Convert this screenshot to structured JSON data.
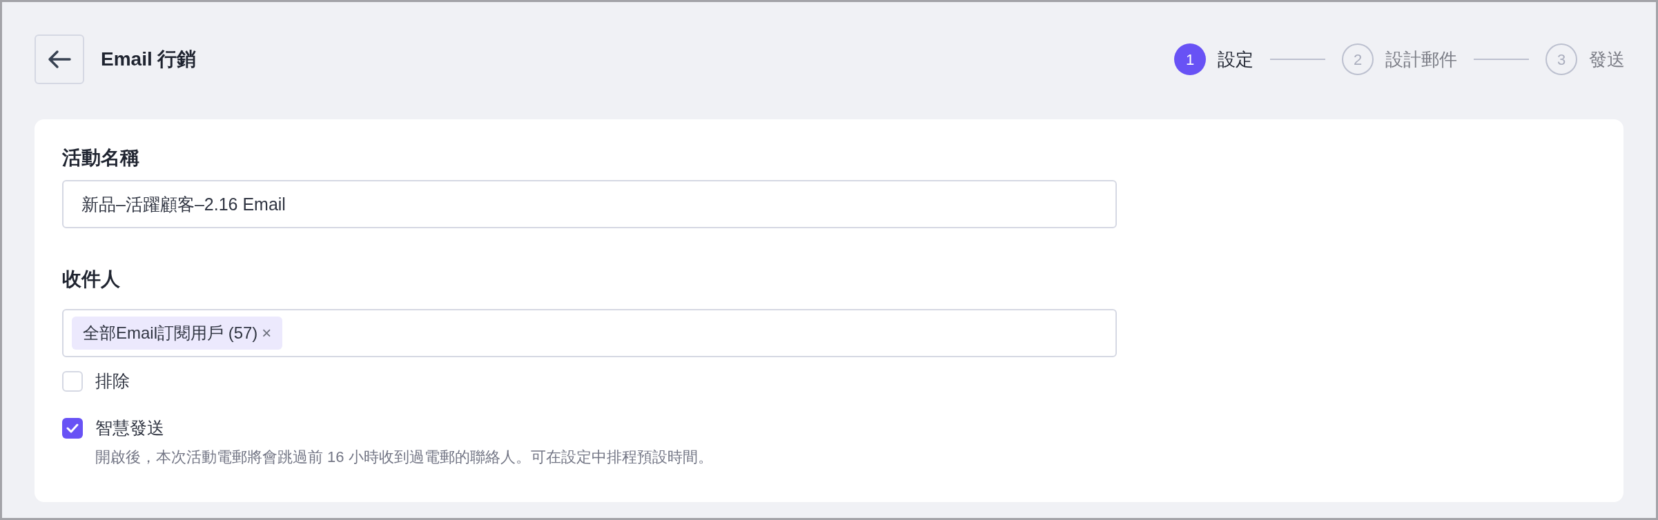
{
  "header": {
    "title": "Email 行銷"
  },
  "steps": [
    {
      "number": "1",
      "label": "設定",
      "selected": true
    },
    {
      "number": "2",
      "label": "設計郵件",
      "selected": false
    },
    {
      "number": "3",
      "label": "發送",
      "selected": false
    }
  ],
  "campaign_name": {
    "label": "活動名稱",
    "value": "新品–活躍顧客–2.16 Email"
  },
  "recipients": {
    "label": "收件人",
    "tags": [
      {
        "label": "全部Email訂閱用戶 (57)",
        "remove": "×"
      }
    ]
  },
  "options": [
    {
      "label": "排除",
      "checked": false
    },
    {
      "label": "智慧發送",
      "checked": true,
      "description": "開啟後，本次活動電郵將會跳過前 16 小時收到過電郵的聯絡人。可在設定中排程預設時間。"
    }
  ]
}
